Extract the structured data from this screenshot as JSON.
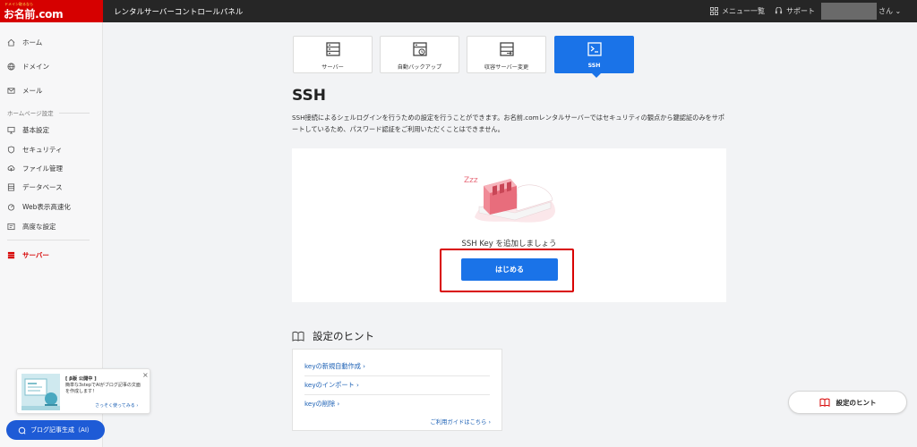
{
  "header": {
    "logo_small": "ドメイン取るなら",
    "logo_main": "お名前.com",
    "title": "レンタルサーバーコントロールパネル",
    "menu_label": "メニュー一覧",
    "support_label": "サポート",
    "user_suffix": "さん"
  },
  "sidebar": {
    "items": [
      {
        "label": "ホーム",
        "icon": "home-icon"
      },
      {
        "label": "ドメイン",
        "icon": "globe-icon"
      },
      {
        "label": "メール",
        "icon": "mail-icon"
      }
    ],
    "section_label": "ホームページ設定",
    "section_items": [
      {
        "label": "基本設定",
        "icon": "monitor-icon"
      },
      {
        "label": "セキュリティ",
        "icon": "shield-icon"
      },
      {
        "label": "ファイル管理",
        "icon": "upload-icon"
      },
      {
        "label": "データベース",
        "icon": "database-icon"
      },
      {
        "label": "Web表示高速化",
        "icon": "speed-icon"
      },
      {
        "label": "高度な設定",
        "icon": "advanced-icon"
      }
    ],
    "server_label": "サーバー"
  },
  "tabs": [
    {
      "label": "サーバー",
      "icon": "server-icon"
    },
    {
      "label": "自動バックアップ",
      "icon": "backup-icon"
    },
    {
      "label": "収容サーバー変更",
      "icon": "server-change-icon"
    },
    {
      "label": "SSH",
      "icon": "terminal-icon"
    }
  ],
  "main": {
    "title": "SSH",
    "description": "SSH接続によるシェルログインを行うための設定を行うことができます。お名前.comレンタルサーバーではセキュリティの観点から鍵認証のみをサポートしているため、パスワード認証をご利用いただくことはできません。",
    "illustration_text": "Zzz",
    "empty_message": "SSH Key を追加しましょう",
    "start_button": "はじめる"
  },
  "hints": {
    "title": "設定のヒント",
    "links": [
      "keyの新規自動作成 ›",
      "keyのインポート ›",
      "keyの削除 ›"
    ],
    "guide_link": "ご利用ガイドはこちら ›"
  },
  "floating_hint_button": "設定のヒント",
  "promo": {
    "title": "[ β版 公開中 ]",
    "text": "簡単な3stepでAIがブログ記事の文面を作成します！",
    "link": "さっそく使ってみる ›",
    "close": "×"
  },
  "ai_button": "ブログ記事生成（AI）",
  "colors": {
    "brand_red": "#d60000",
    "accent_blue": "#1a73e8",
    "header_bg": "#262626"
  }
}
